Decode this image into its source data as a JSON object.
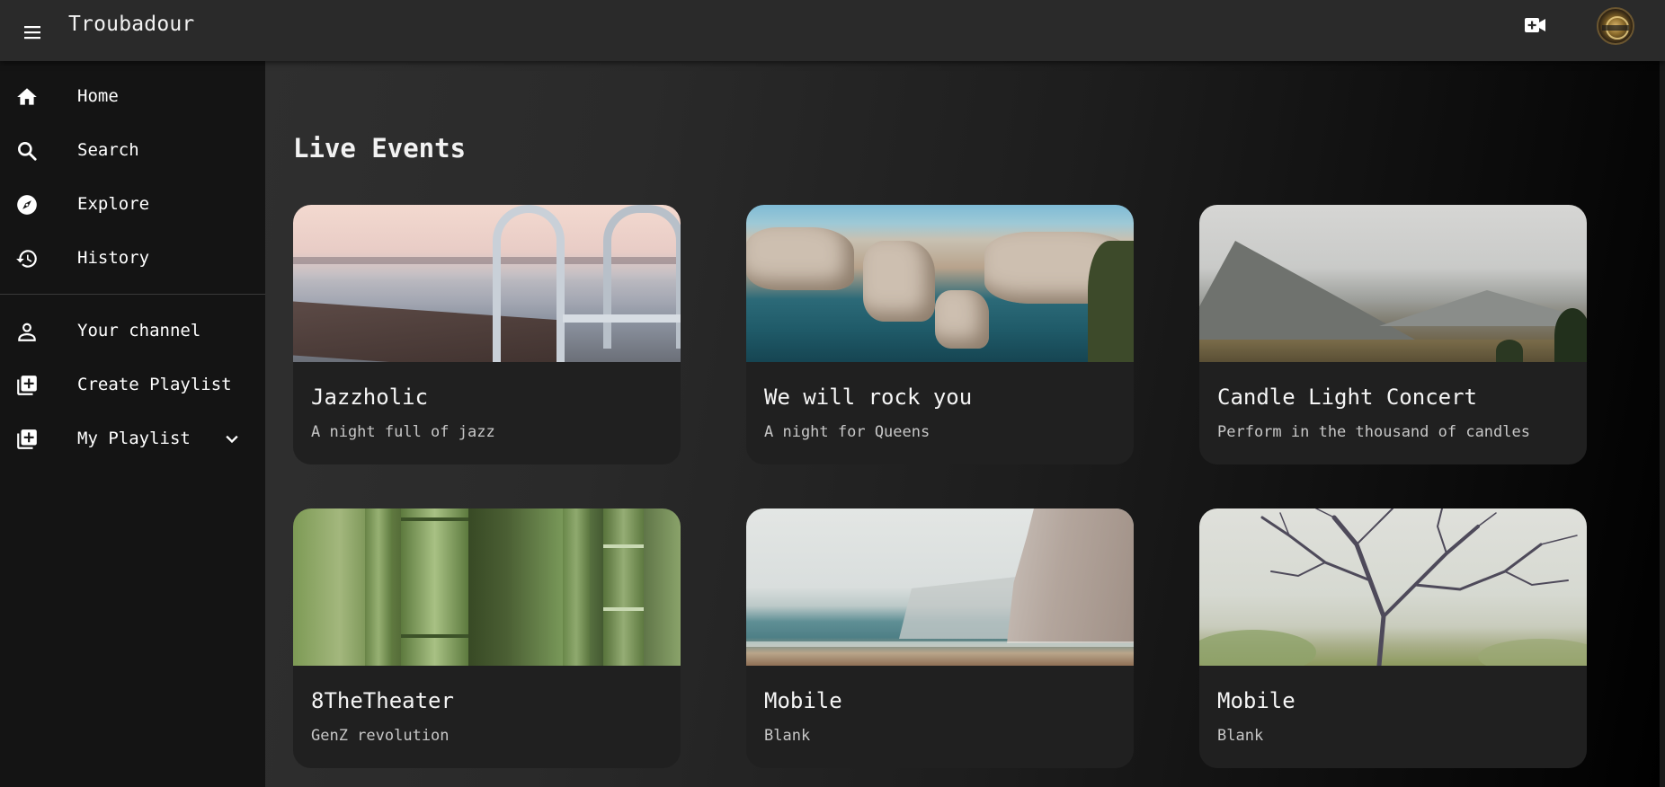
{
  "app": {
    "title": "Troubadour"
  },
  "topbar": {
    "menu_icon": "menu-icon",
    "create_video_icon": "video-call-icon",
    "avatar_icon": "avatar"
  },
  "sidebar": {
    "items": [
      {
        "label": "Home",
        "icon": "home-icon"
      },
      {
        "label": "Search",
        "icon": "search-icon"
      },
      {
        "label": "Explore",
        "icon": "compass-icon"
      },
      {
        "label": "History",
        "icon": "history-icon"
      },
      {
        "label": "Your channel",
        "icon": "person-icon"
      },
      {
        "label": "Create Playlist",
        "icon": "add-box-icon"
      },
      {
        "label": "My Playlist",
        "icon": "add-box-icon",
        "expand_icon": "chevron-down-icon"
      }
    ]
  },
  "main": {
    "section_title": "Live Events",
    "events": [
      {
        "title": "Jazzholic",
        "subtitle": "A night full of jazz",
        "image": "dock-lake"
      },
      {
        "title": "We will rock you",
        "subtitle": "A night for Queens",
        "image": "sea-cliffs"
      },
      {
        "title": "Candle Light Concert",
        "subtitle": "Perform in the thousand of candles",
        "image": "mountain-valley"
      },
      {
        "title": "8TheTheater",
        "subtitle": "GenZ revolution",
        "image": "bamboo"
      },
      {
        "title": "Mobile",
        "subtitle": "Blank",
        "image": "foggy-coast"
      },
      {
        "title": "Mobile",
        "subtitle": "Blank",
        "image": "bare-tree"
      }
    ]
  },
  "colors": {
    "topbar": "#2a2a2a",
    "sidebar": "#141414",
    "card": "#202020",
    "text": "#ffffff",
    "subtext": "#c7c7c7"
  }
}
